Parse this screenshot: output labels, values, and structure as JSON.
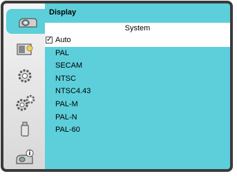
{
  "header": {
    "title": "Display"
  },
  "section": {
    "title": "System"
  },
  "menu": {
    "selected_label": "Auto",
    "options": [
      "PAL",
      "SECAM",
      "NTSC",
      "NTSC4.43",
      "PAL-M",
      "PAL-N",
      "PAL-60"
    ]
  },
  "sidebar": {
    "tabs": [
      {
        "icon": "display-icon",
        "active": true
      },
      {
        "icon": "image-adjust-icon"
      },
      {
        "icon": "setting-gear-icon"
      },
      {
        "icon": "expanded-setting-gears-icon"
      },
      {
        "icon": "usb-icon"
      },
      {
        "icon": "info-icon"
      }
    ]
  },
  "colors": {
    "panel": "#5ccfda",
    "sidebar": "#e6e6e6",
    "frame": "#3a3a3a"
  }
}
